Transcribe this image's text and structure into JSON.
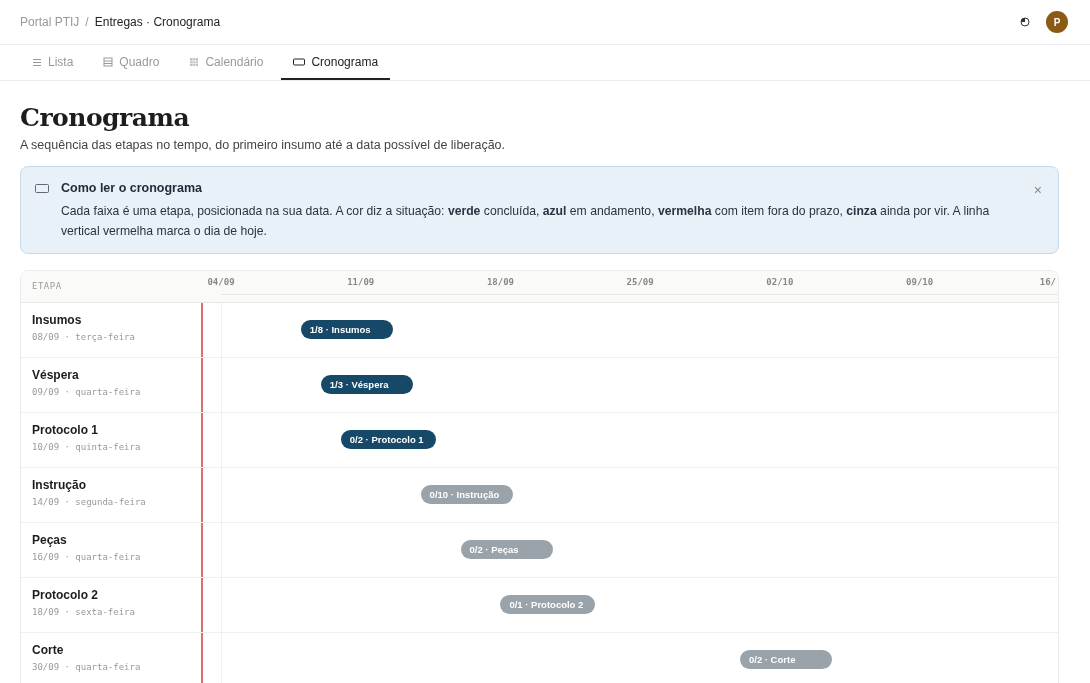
{
  "breadcrumb": {
    "root": "Portal PTIJ",
    "separator": "/",
    "current": "Entregas · Cronograma"
  },
  "user": {
    "initial": "P"
  },
  "tabs": [
    {
      "label": "Lista",
      "kind": "list",
      "selected": false
    },
    {
      "label": "Quadro",
      "kind": "board",
      "selected": false
    },
    {
      "label": "Calendário",
      "kind": "calendar",
      "selected": false
    },
    {
      "label": "Cronograma",
      "kind": "timeline",
      "selected": true
    }
  ],
  "page": {
    "title": "Cronograma",
    "subtitle": "A sequência das etapas no tempo, do primeiro insumo até a data possível de liberação."
  },
  "notice": {
    "title": "Como ler o cronograma",
    "body": "Cada faixa é uma etapa, posicionada na sua data. A cor diz a situação: **verde** concluída, **azul** em andamento, **vermelha** com item fora do prazo, **cinza** ainda por vir. A linha vertical vermelha marca o dia de hoje.",
    "close": "×"
  },
  "timeline": {
    "column_header": "ETAPA",
    "ticks": [
      "04/09",
      "11/09",
      "18/09",
      "25/09",
      "02/10",
      "09/10",
      "16/"
    ],
    "rows": [
      {
        "name": "Insumos",
        "date": "08/09 · terça-feira",
        "bar": "1/8 · Insumos",
        "kind": "in_progress"
      },
      {
        "name": "Véspera",
        "date": "09/09 · quarta-feira",
        "bar": "1/3 · Véspera",
        "kind": "in_progress"
      },
      {
        "name": "Protocolo 1",
        "date": "10/09 · quinta-feira",
        "bar": "0/2 · Protocolo 1",
        "kind": "in_progress"
      },
      {
        "name": "Instrução",
        "date": "14/09 · segunda-feira",
        "bar": "0/10 · Instrução",
        "kind": "upcoming"
      },
      {
        "name": "Peças",
        "date": "16/09 · quarta-feira",
        "bar": "0/2 · Peças",
        "kind": "upcoming"
      },
      {
        "name": "Protocolo 2",
        "date": "18/09 · sexta-feira",
        "bar": "0/1 · Protocolo 2",
        "kind": "upcoming"
      },
      {
        "name": "Corte",
        "date": "30/09 · quarta-feira",
        "bar": "0/2 · Corte",
        "kind": "upcoming"
      }
    ]
  }
}
